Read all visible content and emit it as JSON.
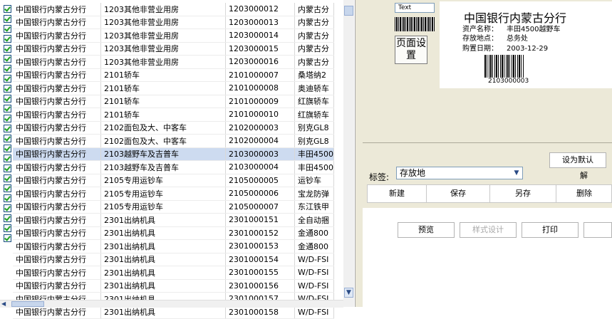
{
  "grid": {
    "rows": [
      {
        "org": "中国银行内蒙古分行",
        "category": "1203其他非营业用房",
        "code": "1203000012",
        "extra": "内蒙古分"
      },
      {
        "org": "中国银行内蒙古分行",
        "category": "1203其他非营业用房",
        "code": "1203000013",
        "extra": "内蒙古分"
      },
      {
        "org": "中国银行内蒙古分行",
        "category": "1203其他非营业用房",
        "code": "1203000014",
        "extra": "内蒙古分"
      },
      {
        "org": "中国银行内蒙古分行",
        "category": "1203其他非营业用房",
        "code": "1203000015",
        "extra": "内蒙古分"
      },
      {
        "org": "中国银行内蒙古分行",
        "category": "1203其他非营业用房",
        "code": "1203000016",
        "extra": "内蒙古分"
      },
      {
        "org": "中国银行内蒙古分行",
        "category": "2101轿车",
        "code": "2101000007",
        "extra": "桑塔纳2"
      },
      {
        "org": "中国银行内蒙古分行",
        "category": "2101轿车",
        "code": "2101000008",
        "extra": "奥迪轿车"
      },
      {
        "org": "中国银行内蒙古分行",
        "category": "2101轿车",
        "code": "2101000009",
        "extra": "红旗轿车"
      },
      {
        "org": "中国银行内蒙古分行",
        "category": "2101轿车",
        "code": "2101000010",
        "extra": "红旗轿车"
      },
      {
        "org": "中国银行内蒙古分行",
        "category": "2102面包及大、中客车",
        "code": "2102000003",
        "extra": "别克GL8"
      },
      {
        "org": "中国银行内蒙古分行",
        "category": "2102面包及大、中客车",
        "code": "2102000004",
        "extra": "别克GL8"
      },
      {
        "org": "中国银行内蒙古分行",
        "category": "2103越野车及吉普车",
        "code": "2103000003",
        "extra": "丰田4500"
      },
      {
        "org": "中国银行内蒙古分行",
        "category": "2103越野车及吉普车",
        "code": "2103000004",
        "extra": "丰田4500"
      },
      {
        "org": "中国银行内蒙古分行",
        "category": "2105专用运钞车",
        "code": "2105000005",
        "extra": "运钞车"
      },
      {
        "org": "中国银行内蒙古分行",
        "category": "2105专用运钞车",
        "code": "2105000006",
        "extra": "宝龙防弹"
      },
      {
        "org": "中国银行内蒙古分行",
        "category": "2105专用运钞车",
        "code": "2105000007",
        "extra": "东江铁甲"
      },
      {
        "org": "中国银行内蒙古分行",
        "category": "2301出纳机具",
        "code": "2301000151",
        "extra": "全自动捆"
      },
      {
        "org": "中国银行内蒙古分行",
        "category": "2301出纳机具",
        "code": "2301000152",
        "extra": "金通800"
      },
      {
        "org": "中国银行内蒙古分行",
        "category": "2301出纳机具",
        "code": "2301000153",
        "extra": "金通800"
      },
      {
        "org": "中国银行内蒙古分行",
        "category": "2301出纳机具",
        "code": "2301000154",
        "extra": "W/D-FSI"
      },
      {
        "org": "中国银行内蒙古分行",
        "category": "2301出纳机具",
        "code": "2301000155",
        "extra": "W/D-FSI"
      },
      {
        "org": "中国银行内蒙古分行",
        "category": "2301出纳机具",
        "code": "2301000156",
        "extra": "W/D-FSI"
      },
      {
        "org": "中国银行内蒙古分行",
        "category": "2301出纳机具",
        "code": "2301000157",
        "extra": "W/D-FSI"
      },
      {
        "org": "中国银行内蒙古分行",
        "category": "2301出纳机具",
        "code": "2301000158",
        "extra": "W/D-FSI"
      }
    ],
    "selected_index": 11
  },
  "designer": {
    "text_field": "Text",
    "page_setup_button": "页面设置"
  },
  "label_preview": {
    "title": "中国银行内蒙古分行",
    "asset_name_label": "资产名称：",
    "asset_name_value": "丰田4500越野车",
    "location_label": "存放地点：",
    "location_value": "总务处",
    "purchase_date_label": "购置日期：",
    "purchase_date_value": "2003-12-29",
    "barcode_number": "2103000003"
  },
  "controls": {
    "set_default_button": "设为默认",
    "tag_label": "标签:",
    "tag_selected": "存放地",
    "unlock_label": "解",
    "new_button": "新建",
    "save_button": "保存",
    "save_as_button": "另存",
    "delete_button": "删除",
    "preview_button": "预览",
    "style_design_button": "样式设计",
    "print_button": "打印"
  }
}
